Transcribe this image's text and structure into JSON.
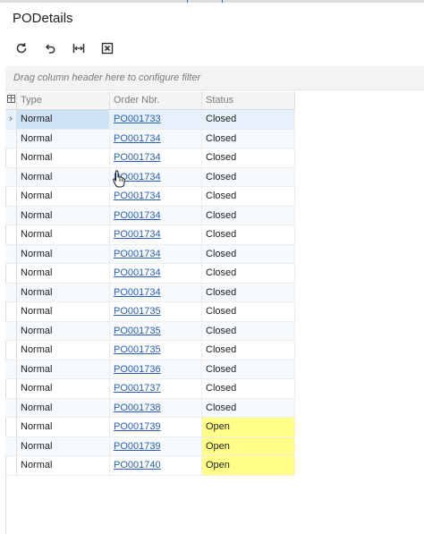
{
  "window": {
    "title": "PODetails"
  },
  "toolbar": {
    "buttons": [
      {
        "name": "refresh-button",
        "icon": "refresh-icon"
      },
      {
        "name": "undo-button",
        "icon": "undo-icon"
      },
      {
        "name": "fit-columns-button",
        "icon": "fit-columns-icon"
      },
      {
        "name": "export-excel-button",
        "icon": "excel-icon"
      }
    ]
  },
  "filter": {
    "placeholder": "Drag column header here to configure filter"
  },
  "grid": {
    "columns": [
      "Type",
      "Order Nbr.",
      "Status"
    ],
    "rows": [
      {
        "type": "Normal",
        "order": "PO001733",
        "status": "Closed"
      },
      {
        "type": "Normal",
        "order": "PO001734",
        "status": "Closed"
      },
      {
        "type": "Normal",
        "order": "PO001734",
        "status": "Closed"
      },
      {
        "type": "Normal",
        "order": "PO001734",
        "status": "Closed"
      },
      {
        "type": "Normal",
        "order": "PO001734",
        "status": "Closed"
      },
      {
        "type": "Normal",
        "order": "PO001734",
        "status": "Closed"
      },
      {
        "type": "Normal",
        "order": "PO001734",
        "status": "Closed"
      },
      {
        "type": "Normal",
        "order": "PO001734",
        "status": "Closed"
      },
      {
        "type": "Normal",
        "order": "PO001734",
        "status": "Closed"
      },
      {
        "type": "Normal",
        "order": "PO001734",
        "status": "Closed"
      },
      {
        "type": "Normal",
        "order": "PO001735",
        "status": "Closed"
      },
      {
        "type": "Normal",
        "order": "PO001735",
        "status": "Closed"
      },
      {
        "type": "Normal",
        "order": "PO001735",
        "status": "Closed"
      },
      {
        "type": "Normal",
        "order": "PO001736",
        "status": "Closed"
      },
      {
        "type": "Normal",
        "order": "PO001737",
        "status": "Closed"
      },
      {
        "type": "Normal",
        "order": "PO001738",
        "status": "Closed"
      },
      {
        "type": "Normal",
        "order": "PO001739",
        "status": "Open"
      },
      {
        "type": "Normal",
        "order": "PO001739",
        "status": "Open"
      },
      {
        "type": "Normal",
        "order": "PO001740",
        "status": "Open"
      }
    ],
    "active_row": 0,
    "highlight_status": "Open"
  },
  "colors": {
    "link": "#2a5fb1",
    "open_highlight": "#ffff8a",
    "active_row": "#e6f1fb"
  }
}
